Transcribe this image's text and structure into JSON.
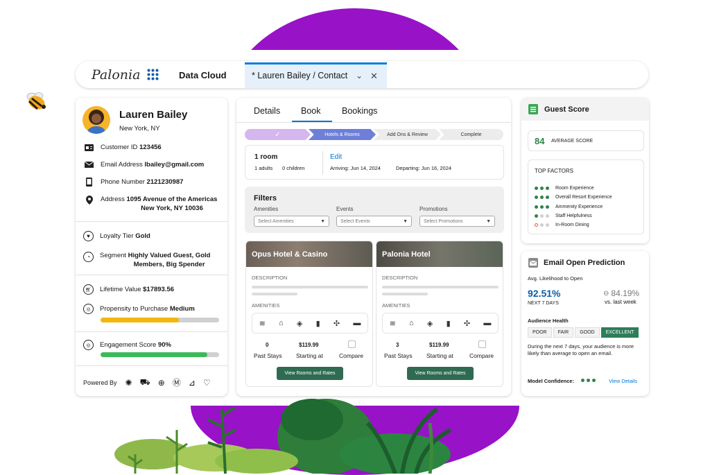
{
  "header": {
    "logo": "Palonia",
    "app_name": "Data Cloud",
    "tab_label": "* Lauren Bailey / Contact"
  },
  "contact": {
    "name": "Lauren Bailey",
    "location": "New York, NY",
    "customer_id_label": "Customer ID",
    "customer_id": "123456",
    "email_label": "Email Address",
    "email": "lbailey@gmail.com",
    "phone_label": "Phone Number",
    "phone": "2121230987",
    "address_label": "Address",
    "address_line1": "1095 Avenue of the Americas",
    "address_line2": "New York, NY 10036",
    "loyalty_label": "Loyalty Tier",
    "loyalty": "Gold",
    "segment_label": "Segment",
    "segment_line1": "Highly Valued Guest, Gold",
    "segment_line2": "Members, Big Spender",
    "ltv_label": "Lifetime Value",
    "ltv": "$17893.56",
    "propensity_label": "Propensity to Purchase",
    "propensity": "Medium",
    "propensity_fill": 0.66,
    "propensity_color": "#f3b70c",
    "engagement_label": "Engagement Score",
    "engagement": "90%",
    "engagement_fill": 0.9,
    "engagement_color": "#3cb95a",
    "powered_by": "Powered By",
    "powered_icons": [
      "sparkle-icon",
      "cart-icon",
      "search-people-icon",
      "m-badge-icon",
      "chart-icon",
      "heart-icon"
    ]
  },
  "booking": {
    "tabs": [
      "Details",
      "Book",
      "Bookings"
    ],
    "active_tab": "Book",
    "steps": [
      "Hotels & Rooms",
      "Add Ons & Review",
      "Complete"
    ],
    "room_title": "1 room",
    "adults": "1 adults",
    "children": "0 children",
    "edit": "Edit",
    "arriving": "Arriving: Jun 14, 2024",
    "departing": "Departing: Jun 16, 2024",
    "filters_title": "Filters",
    "filters": [
      {
        "label": "Amenities",
        "placeholder": "Select Amenities"
      },
      {
        "label": "Events",
        "placeholder": "Select Events"
      },
      {
        "label": "Promotions",
        "placeholder": "Select Promotions"
      }
    ],
    "hotels": [
      {
        "name": "Opus Hotel & Casino",
        "description": "DESCRIPTION",
        "amenities": "AMENITIES",
        "past_stays": "0",
        "past_stays_label": "Past Stays",
        "price": "$119.99",
        "price_label": "Starting at",
        "compare": "Compare",
        "button": "View Rooms and Rates"
      },
      {
        "name": "Palonia Hotel",
        "description": "DESCRIPTION",
        "amenities": "AMENITIES",
        "past_stays": "3",
        "past_stays_label": "Past Stays",
        "price": "$119.99",
        "price_label": "Starting at",
        "compare": "Compare",
        "button": "View Rooms and Rates"
      }
    ]
  },
  "guest_score": {
    "title": "Guest Score",
    "score": "84",
    "score_label": "AVERAGE SCORE",
    "factors_title": "TOP FACTORS",
    "factors": [
      {
        "label": "Room Experience",
        "level": 3,
        "color": "#2e844a"
      },
      {
        "label": "Overall Resort Experience",
        "level": 3,
        "color": "#2e844a"
      },
      {
        "label": "Ammenity Experience",
        "level": 3,
        "color": "#2e844a"
      },
      {
        "label": "Staff Helpfulness",
        "level": 1,
        "color": "#2e844a"
      },
      {
        "label": "In-Room Dining",
        "level": 0,
        "color": "#e04f3f"
      }
    ]
  },
  "email": {
    "title": "Email Open Prediction",
    "avg_label": "Avg. Likelihood to Open",
    "pct": "92.51%",
    "pct_label": "NEXT 7 DAYS",
    "prev_pct": "84.19%",
    "prev_label": "vs. last week",
    "health_title": "Audience Health",
    "health": [
      "POOR",
      "FAIR",
      "GOOD",
      "EXCELLENT"
    ],
    "health_active": "EXCELLENT",
    "desc": "During the next 7 days, your audience is more likely than average to open an email.",
    "confidence_label": "Model Confidence:",
    "view_details": "View Details"
  },
  "colors": {
    "purple": "#9812c8",
    "accent_blue": "#0176d3",
    "green_button": "#2e6b52",
    "chip_active": "#2e7d5b"
  }
}
